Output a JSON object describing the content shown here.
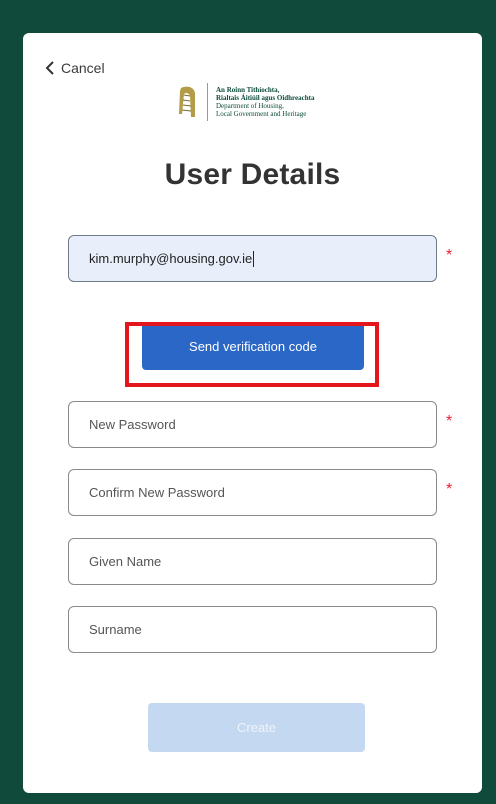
{
  "cancel": {
    "label": "Cancel"
  },
  "logo": {
    "line1": "An Roinn Tithíochta,",
    "line2": "Rialtais Áitiúil agus Oidhreachta",
    "line3": "Department of Housing,",
    "line4": "Local Government and Heritage"
  },
  "title": "User Details",
  "form": {
    "email_value": "kim.murphy@housing.gov.ie",
    "required_mark": "*",
    "send_code_label": "Send verification code",
    "new_password_placeholder": "New Password",
    "confirm_password_placeholder": "Confirm New Password",
    "given_name_placeholder": "Given Name",
    "surname_placeholder": "Surname",
    "create_label": "Create"
  },
  "colors": {
    "background": "#0f4a3b",
    "primary_button": "#2b67c6",
    "disabled_button": "#c5d8f1",
    "highlight": "#e3161d",
    "required": "#ee2233"
  }
}
